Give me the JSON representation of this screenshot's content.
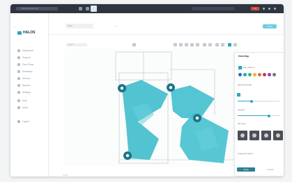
{
  "os_bar": {
    "tab_title": "Wireless Planning",
    "badge": "•••"
  },
  "app": {
    "logo_text": "HALOS",
    "back_arrow": "‹",
    "doc_name": "Floor",
    "close_glyph": "×",
    "publish_label": "Save"
  },
  "sidebar": {
    "items": [
      {
        "label": "Dashboard",
        "icon": "grid-icon"
      },
      {
        "label": "Projects",
        "icon": "folder-icon"
      },
      {
        "label": "Floor Plans",
        "icon": "map-icon"
      },
      {
        "label": "Heatmaps",
        "icon": "layers-icon"
      },
      {
        "label": "Devices",
        "icon": "router-icon"
      },
      {
        "label": "Reports",
        "icon": "chart-icon"
      },
      {
        "label": "Settings",
        "icon": "gear-icon"
      },
      {
        "label": "Help",
        "icon": "help-icon"
      },
      {
        "label": "Users",
        "icon": "user-icon"
      },
      {
        "label": "Logout",
        "icon": "exit-icon"
      }
    ]
  },
  "toolbar": {
    "search_placeholder": "Search"
  },
  "panel": {
    "title": "Heat Map",
    "close": "×",
    "section_color": "Color scheme",
    "section_signal": "Signal strength",
    "section_opacity": "Opacity",
    "section_ap": "AP icons",
    "section_band": "Frequency band",
    "apply_label": "Apply",
    "cancel_label": "Cancel",
    "swatches": [
      "#1f6fb8",
      "#2aa6c0",
      "#36b37e",
      "#f2b233",
      "#e46b3e",
      "#c6374a",
      "#8e44ad",
      "#6b7785"
    ]
  },
  "footer": {
    "zoom_text": "100%"
  }
}
